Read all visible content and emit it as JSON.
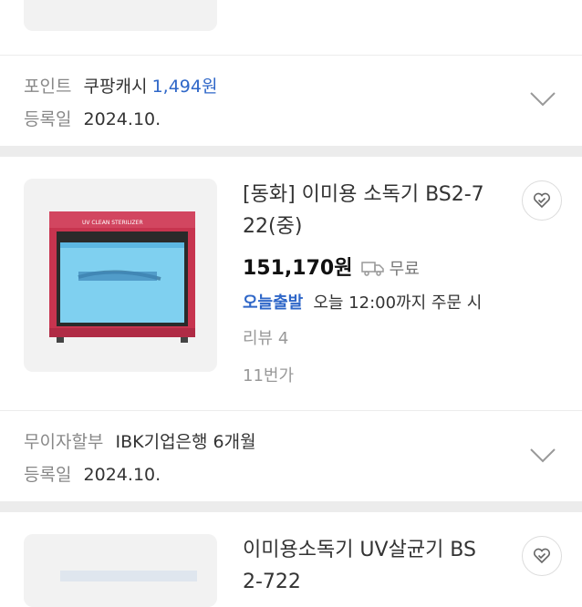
{
  "item1": {
    "meta": {
      "point_label": "포인트",
      "point_text": "쿠팡캐시",
      "point_amount": "1,494원",
      "date_label": "등록일",
      "date_value": "2024.10."
    }
  },
  "item2": {
    "title_line1": "[동화] 이미용 소독기 BS2-7",
    "title_line2": "22(중)",
    "price": "151,170원",
    "shipping": "무료",
    "delivery_badge": "오늘출발",
    "delivery_text": "오늘 12:00까지 주문 시",
    "review": "리뷰 4",
    "rank": "11번가",
    "product_label_top": "UV CLEAN STERILIZER",
    "meta": {
      "installment_label": "무이자할부",
      "installment_value": "IBK기업은행 6개월",
      "date_label": "등록일",
      "date_value": "2024.10."
    }
  },
  "item3": {
    "title_line1": "이미용소독기 UV살균기 BS",
    "title_line2": "2-722"
  },
  "icons": [
    "chevron-down-icon",
    "heart-icon",
    "truck-icon"
  ]
}
